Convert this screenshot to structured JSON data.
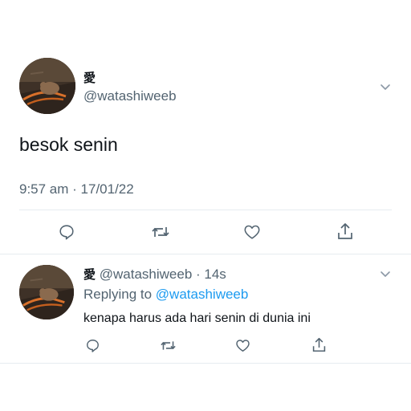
{
  "tweet": {
    "display_name": "愛",
    "handle": "@watashiweeb",
    "text": "besok senin",
    "timestamp": "9:57 am · 17/01/22",
    "avatar_icon": "cat-sleeping-avatar",
    "menu_icon": "chevron-down-icon",
    "actions": [
      "reply-icon",
      "retweet-icon",
      "like-icon",
      "share-icon"
    ]
  },
  "reply": {
    "display_name": "愛",
    "handle_time": "@watashiweeb · 14s",
    "replying_to_prefix": "Replying to",
    "replying_to_handle": "@watashiweeb",
    "text": "kenapa harus ada hari senin di dunia ini",
    "actions": [
      "reply-icon",
      "retweet-icon",
      "like-icon",
      "share-icon"
    ]
  },
  "colors": {
    "text": "#0f1419",
    "muted": "#536471",
    "link": "#1d9bf0",
    "divider": "#e6ecf0"
  }
}
